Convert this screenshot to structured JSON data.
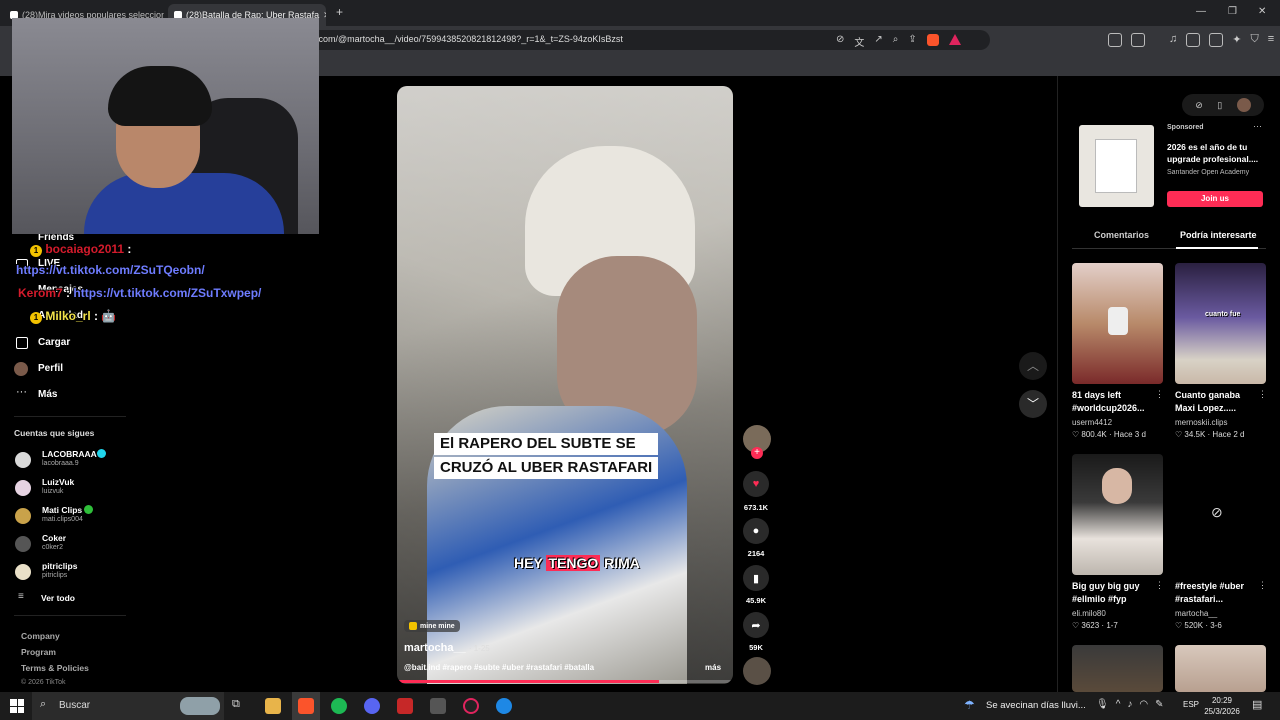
{
  "browser": {
    "tabs": [
      {
        "label": "(28)Mira videos populares seleccion"
      },
      {
        "label": "(28)Batalla de Rap: Uber Rastafa"
      }
    ],
    "new_tab_symbol": "+",
    "url": ".com/@martocha__/video/7599438520821812498?_r=1&_t=ZS-94zoKIsBzst",
    "window_controls": {
      "minimize": "—",
      "restore": "❐",
      "close": "✕"
    }
  },
  "sidebar": {
    "nav": [
      {
        "label": "Friends"
      },
      {
        "label": "LIVE"
      },
      {
        "label": "Mensajes"
      },
      {
        "label": "Actividad"
      },
      {
        "label": "Cargar"
      },
      {
        "label": "Perfil"
      },
      {
        "label": "Más"
      }
    ],
    "following_header": "Cuentas que sigues",
    "accounts": [
      {
        "name": "LACOBRAAA",
        "user": "lacobraaa.9",
        "verified": true
      },
      {
        "name": "LuizVuk",
        "user": "luizvuk"
      },
      {
        "name": "Mati Clips",
        "user": "mati.clips004",
        "online": true
      },
      {
        "name": "Coker",
        "user": "c0ker2"
      },
      {
        "name": "pitriclips",
        "user": "pitriclips"
      }
    ],
    "see_all": "Ver todo",
    "footer": [
      "Company",
      "Program",
      "Terms & Policies",
      "© 2026 TikTok"
    ]
  },
  "chat": [
    {
      "badge": "1",
      "user": "bocaiago2011",
      "sep": ":",
      "message": ""
    },
    {
      "badge": "",
      "user": "",
      "sep": "",
      "message": "https://vt.tiktok.com/ZSuTQeobn/"
    },
    {
      "badge": "",
      "user": "Kerom7",
      "sep": ":",
      "message": "https://vt.tiktok.com/ZSuTxwpep/"
    },
    {
      "badge": "1",
      "user": "Milko_rl",
      "sep": ":",
      "message": "🤖"
    }
  ],
  "video": {
    "caption_line1": "El RAPERO DEL SUBTE SE",
    "caption_line2": "CRUZÓ AL UBER RASTAFARI",
    "subtitle_pre": "HEY",
    "subtitle_highlight": "TENGO",
    "subtitle_post": "RIMA",
    "music_chip": "mine mine",
    "author": "martocha__",
    "date": "· 1-25",
    "description": "@bait.ind #rapero #subte #uber #rastafari #batalla",
    "more": "más",
    "progress": 0.78
  },
  "actions": {
    "likes": "673.1K",
    "comments": "2164",
    "saves": "45.9K",
    "shares": "59K"
  },
  "right_panel": {
    "ad": {
      "sponsored": "Sponsored",
      "title": "2026 es el año de tu upgrade profesional....",
      "advertiser": "Santander Open Academy",
      "cta": "Join us",
      "more": "···"
    },
    "tabs": [
      {
        "label": "Comentarios",
        "active": false
      },
      {
        "label": "Podría interesarte",
        "active": true
      }
    ],
    "cards": [
      {
        "title": "81 days left #worldcup2026...",
        "user": "userm4412",
        "likes": "800.4K",
        "date": "Hace 3 d"
      },
      {
        "title": "Cuanto ganaba Maxi Lopez.....",
        "user": "mernoskii.clips",
        "likes": "34.5K",
        "date": "Hace 2 d",
        "overlay": "cuanto fue"
      },
      {
        "title": "Big guy big guy #ellmilo #fyp",
        "user": "eli.milo80",
        "likes": "3623",
        "date": "1-7"
      },
      {
        "title": "#freestyle #uber #rastafari...",
        "user": "martocha__",
        "likes": "520K",
        "date": "3-6"
      }
    ]
  },
  "taskbar": {
    "search": "Buscar",
    "weather": "Se avecinan días lluvi...",
    "lang": "ESP",
    "time": "20:29",
    "date": "25/3/2026"
  }
}
